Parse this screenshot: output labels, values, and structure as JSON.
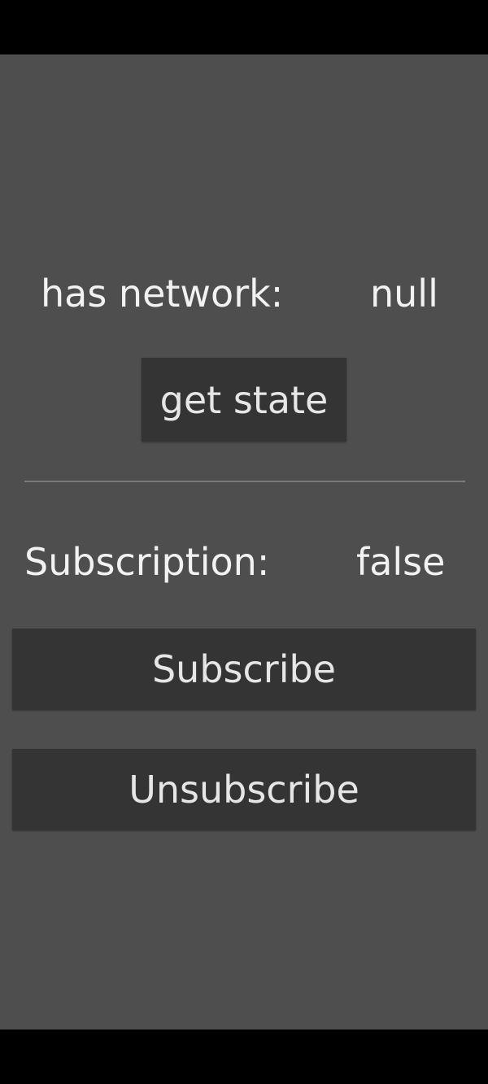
{
  "network": {
    "label": "has network:",
    "value": "null",
    "get_state_label": "get state"
  },
  "subscription": {
    "label": "Subscription:",
    "value": "false",
    "subscribe_label": "Subscribe",
    "unsubscribe_label": "Unsubscribe"
  },
  "colors": {
    "background": "#4e4e4e",
    "button": "#343434",
    "text": "#f2f2f2",
    "divider": "#7a7a7a"
  }
}
